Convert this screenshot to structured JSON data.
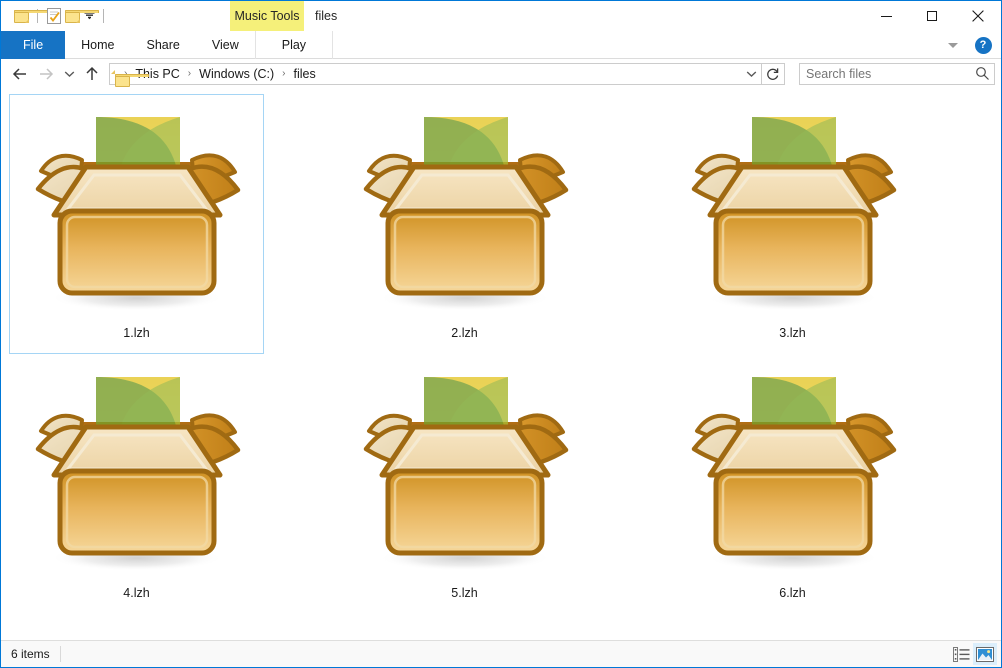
{
  "window": {
    "title": "files",
    "contextual_tab_group": "Music Tools",
    "quick_access": [
      {
        "name": "folder-icon",
        "label": "Properties"
      },
      {
        "name": "checkdoc-icon",
        "label": "New folder"
      },
      {
        "name": "folder-icon",
        "label": "Customize Quick Access Toolbar"
      }
    ],
    "controls": {
      "minimize": "Minimize",
      "maximize": "Maximize",
      "close": "Close"
    }
  },
  "ribbon": {
    "tabs": [
      {
        "label": "File",
        "active": true
      },
      {
        "label": "Home",
        "active": false
      },
      {
        "label": "Share",
        "active": false
      },
      {
        "label": "View",
        "active": false
      },
      {
        "label": "Play",
        "active": false,
        "contextual": true
      }
    ],
    "collapse_label": "Minimize the Ribbon",
    "help_label": "?"
  },
  "address": {
    "back": "←",
    "forward": "→",
    "recent": "⌄",
    "up": "↑",
    "breadcrumbs": [
      "This PC",
      "Windows (C:)",
      "files"
    ],
    "separator": "›",
    "dropdown": "⌄",
    "refresh": "↻"
  },
  "search": {
    "placeholder": "Search files",
    "value": ""
  },
  "files": {
    "items": [
      {
        "name": "1.lzh",
        "selected": true
      },
      {
        "name": "2.lzh",
        "selected": false
      },
      {
        "name": "3.lzh",
        "selected": false
      },
      {
        "name": "4.lzh",
        "selected": false
      },
      {
        "name": "5.lzh",
        "selected": false
      },
      {
        "name": "6.lzh",
        "selected": false
      }
    ]
  },
  "status": {
    "count": "6 items",
    "views": [
      {
        "name": "details-view",
        "active": false
      },
      {
        "name": "large-icons-view",
        "active": true
      }
    ]
  },
  "colors": {
    "accent": "#1673c4",
    "contextual": "#f5f07a",
    "selection_border": "#a5d5f5",
    "box_outline": "#a06a12",
    "box_body_top": "#d99b2a",
    "box_body_bottom": "#f3cd86",
    "sheet_yellow": "#e8d33a",
    "sheet_green": "#6a9a28"
  }
}
